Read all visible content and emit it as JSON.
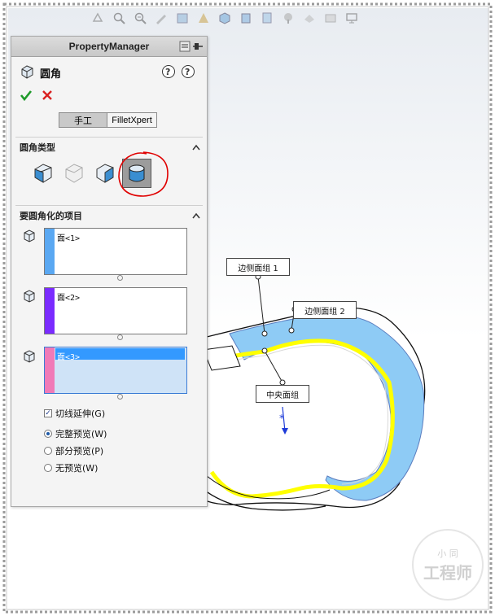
{
  "panel": {
    "title": "PropertyManager",
    "feature_name": "圆角",
    "tabs": {
      "manual": "手工",
      "filletxpert": "FilletXpert"
    },
    "fillet_type": {
      "title": "圆角类型",
      "selected_index": 3
    },
    "items_to_fillet": {
      "title": "要圆角化的项目",
      "lists": [
        {
          "value": "面<1>",
          "color": "#5aa8f2",
          "selected": false
        },
        {
          "value": "面<2>",
          "color": "#7a2bff",
          "selected": false
        },
        {
          "value": "面<3>",
          "color": "#f07ab8",
          "selected": true
        }
      ]
    },
    "options": {
      "tangent_propagation": {
        "label": "切线延伸(G)",
        "checked": true
      },
      "preview": [
        {
          "label": "完整预览(W)",
          "selected": true
        },
        {
          "label": "部分预览(P)",
          "selected": false
        },
        {
          "label": "无预览(W)",
          "selected": false
        }
      ]
    }
  },
  "callouts": {
    "side_face_1": "边侧面组 1",
    "side_face_2": "边侧面组 2",
    "center_face": "中央面组"
  },
  "watermark": {
    "top": "小  同",
    "main": "工程师"
  },
  "colors": {
    "face_blue": "#8ecbf5",
    "face_yellow": "#ffff00",
    "highlight_circle": "#e00000"
  }
}
